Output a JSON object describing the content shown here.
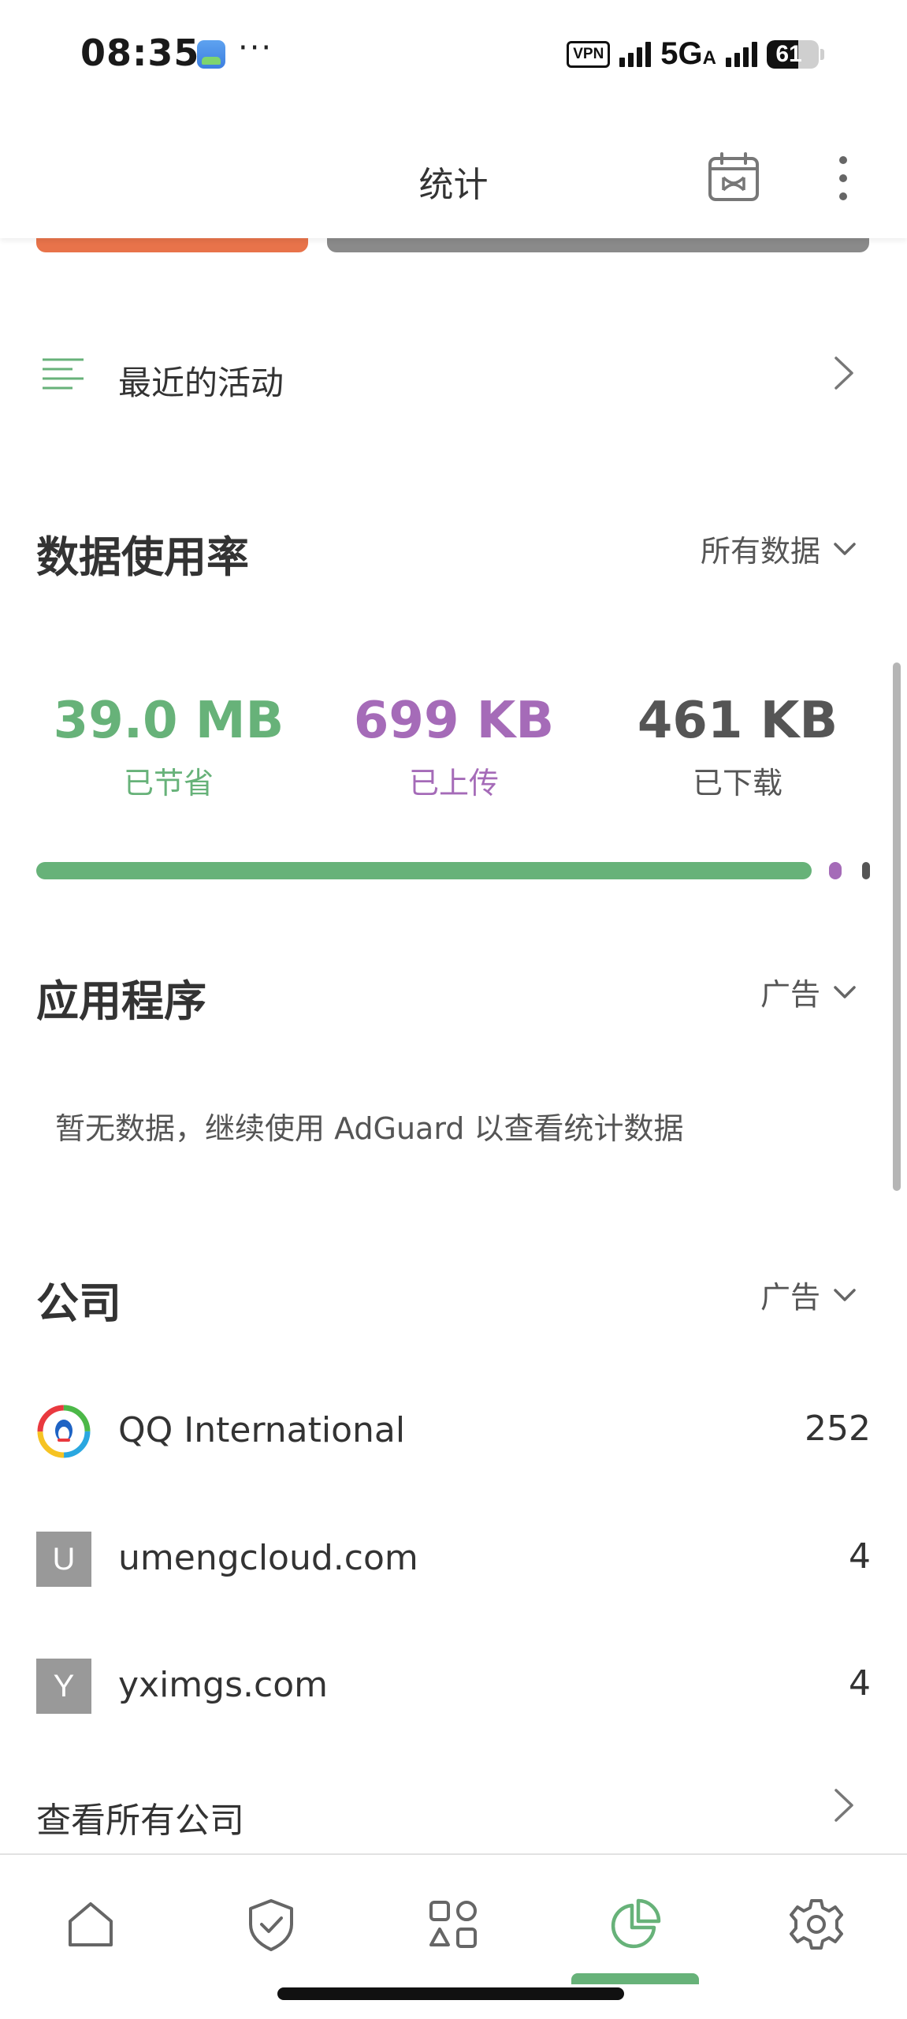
{
  "status_bar": {
    "time": "08:35",
    "dots": "···",
    "vpn": "VPN",
    "network": "5G",
    "network_sub": "A",
    "battery": "61",
    "battery_level": 0.61
  },
  "header": {
    "title": "统计",
    "calendar_icon": "calendar-icon",
    "more_icon": "more-vertical-icon"
  },
  "recent_activity": {
    "label": "最近的活动"
  },
  "data_usage": {
    "title": "数据使用率",
    "filter": "所有数据",
    "saved": {
      "value": "39.0 MB",
      "label": "已节省",
      "color": "#67b279"
    },
    "uploaded": {
      "value": "699 KB",
      "label": "已上传",
      "color": "#a56bb8"
    },
    "downloaded": {
      "value": "461 KB",
      "label": "已下载",
      "color": "#555555"
    }
  },
  "applications": {
    "title": "应用程序",
    "filter": "广告",
    "empty_text": "暂无数据，继续使用 AdGuard 以查看统计数据"
  },
  "companies": {
    "title": "公司",
    "filter": "广告",
    "items": [
      {
        "name": "QQ International",
        "count": "252",
        "logo": "qq-logo"
      },
      {
        "name": "umengcloud.com",
        "count": "4",
        "letter": "U"
      },
      {
        "name": "yximgs.com",
        "count": "4",
        "letter": "Y"
      }
    ],
    "view_all": "查看所有公司"
  },
  "bottom_nav": {
    "items": [
      "home-icon",
      "shield-check-icon",
      "apps-icon",
      "statistics-icon",
      "settings-icon"
    ],
    "active": "statistics-icon",
    "active_color": "#67b279",
    "inactive_color": "#666666"
  }
}
